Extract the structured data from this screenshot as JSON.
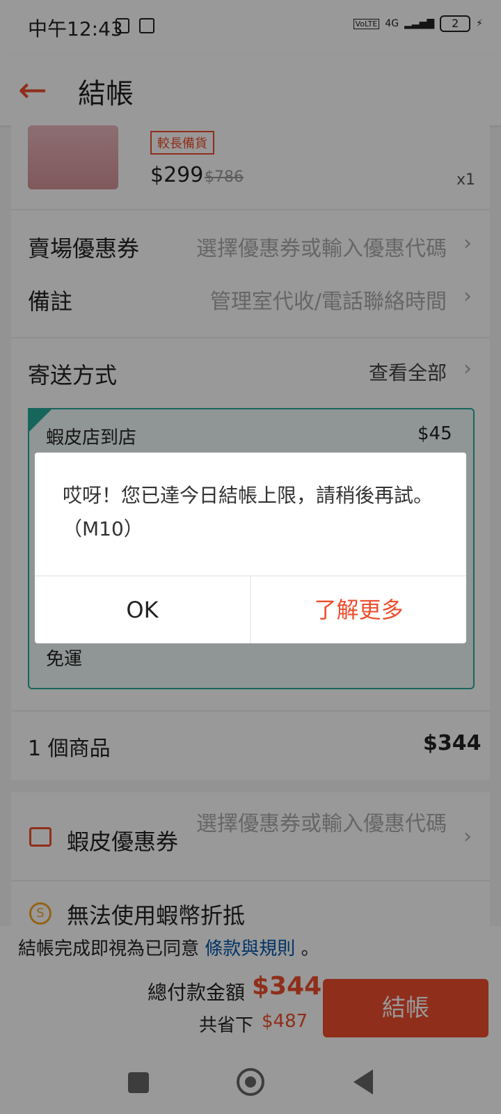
{
  "status_bar": {
    "time": "中午12:43",
    "network": "4G",
    "battery": "2"
  },
  "header": {
    "title": "結帳"
  },
  "product": {
    "tag": "較長備貨",
    "price": "$299",
    "original_price": "$786",
    "quantity": "x1"
  },
  "rows": {
    "shop_voucher": {
      "label": "賣場優惠券",
      "hint": "選擇優惠券或輸入優惠代碼"
    },
    "note": {
      "label": "備註",
      "hint": "管理室代收/電話聯絡時間"
    },
    "shipping": {
      "label": "寄送方式",
      "hint": "查看全部"
    }
  },
  "shipping_option": {
    "name": "蝦皮店到店",
    "price": "$45",
    "free_text": "免運"
  },
  "subtotal": {
    "label": "1 個商品",
    "value": "$344"
  },
  "platform_voucher": {
    "label": "蝦皮優惠券",
    "hint": "選擇優惠券或輸入優惠代碼"
  },
  "coins": {
    "label": "無法使用蝦幣折抵"
  },
  "terms": {
    "text": "結帳完成即視為已同意",
    "link": "條款與規則",
    "suffix": "。"
  },
  "bottom_bar": {
    "total_label": "總付款金額",
    "total_value": "$344",
    "saved_label": "共省下",
    "saved_value": "$487",
    "checkout_label": "結帳"
  },
  "dialog": {
    "message_line1": "哎呀！您已達今日結帳上限，請稍後再試。",
    "message_line2": "（M10）",
    "ok_label": "OK",
    "more_label": "了解更多"
  },
  "colors": {
    "accent": "#ee4d2d",
    "link": "#0055aa",
    "shipping_border": "#26aa99"
  }
}
